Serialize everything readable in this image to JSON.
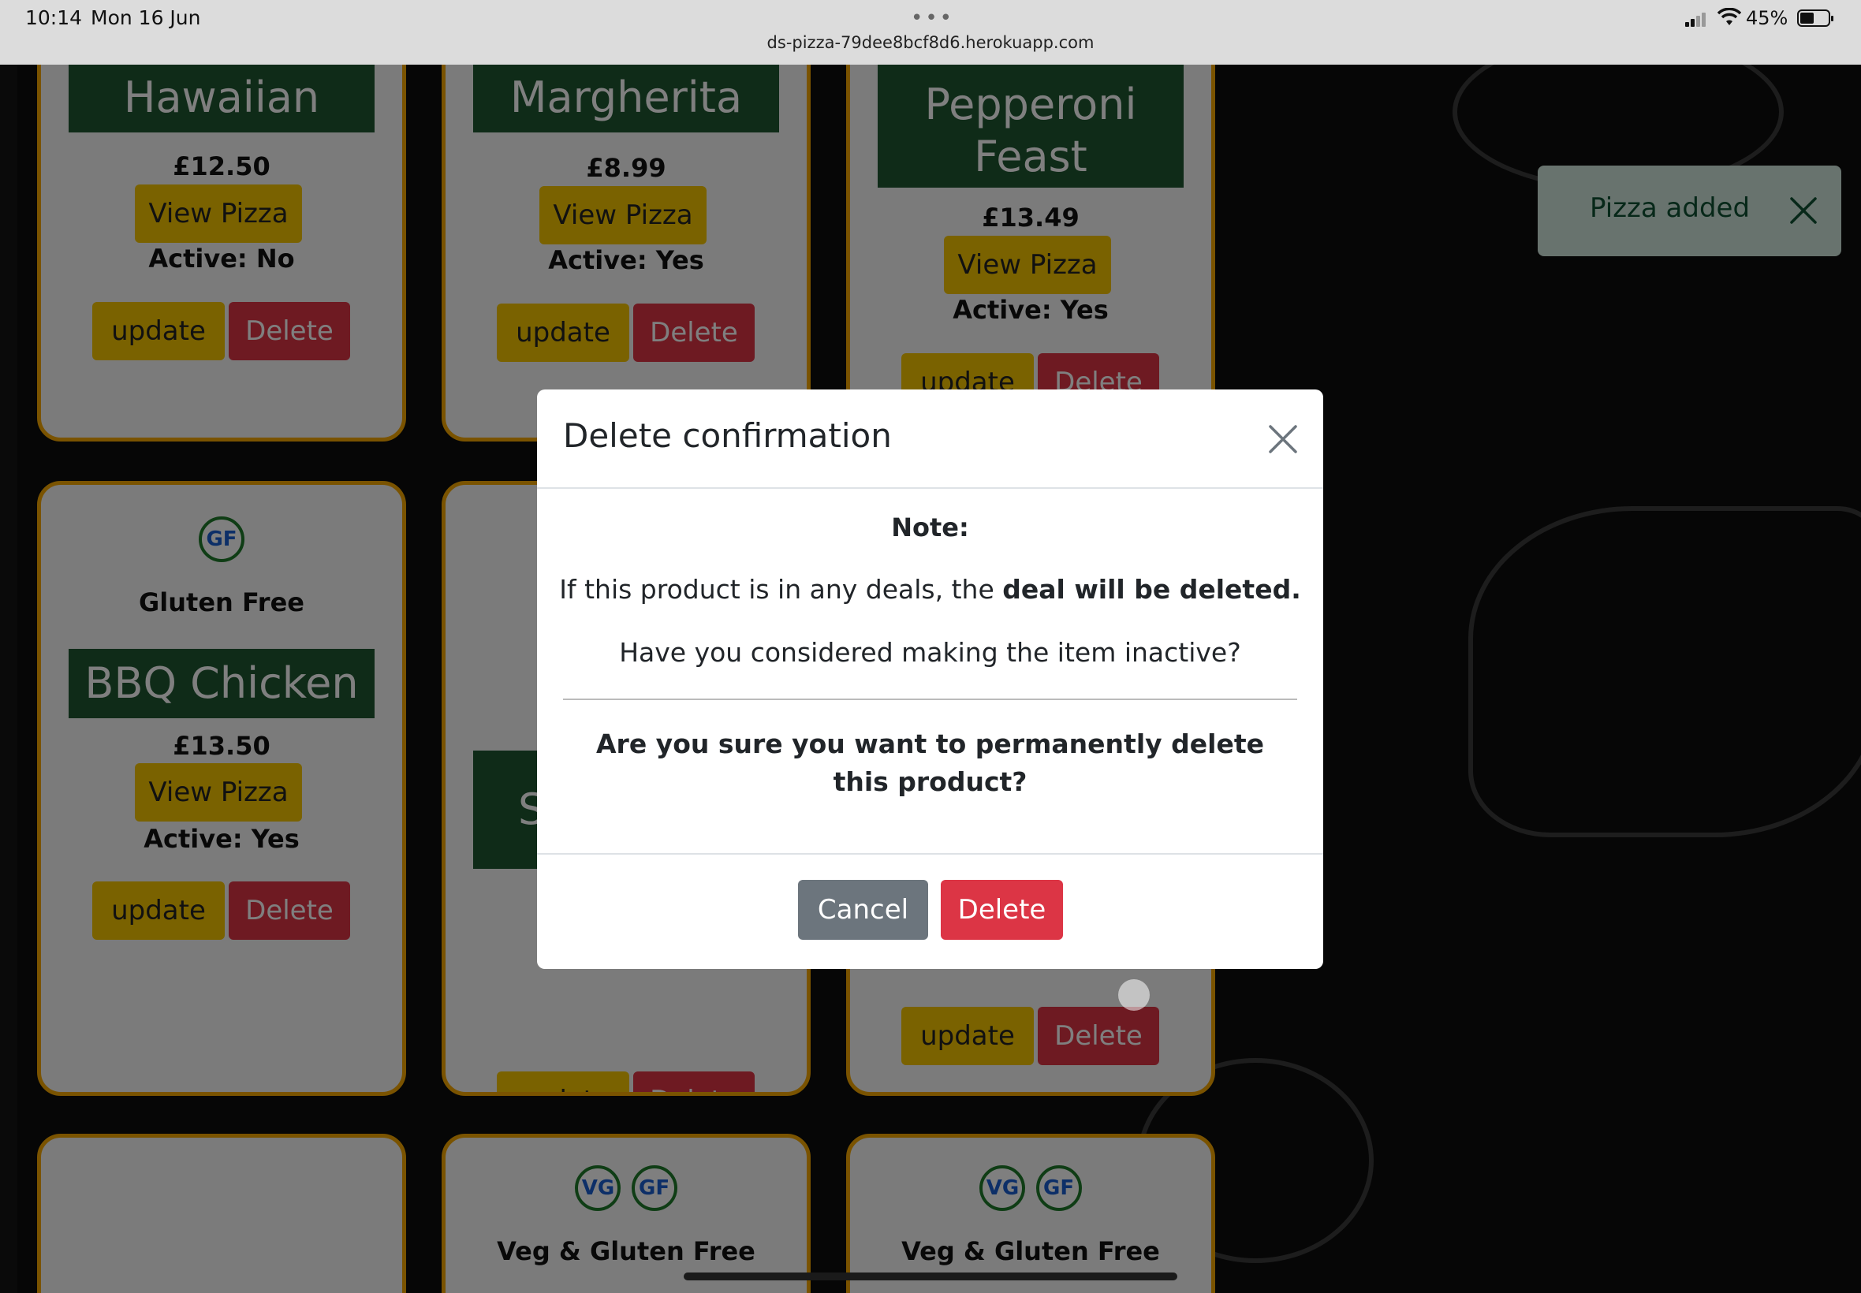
{
  "status_bar": {
    "time": "10:14",
    "date": "Mon 16 Jun",
    "url": "ds-pizza-79dee8bcf8d6.herokuapp.com",
    "battery": "45%"
  },
  "toast": {
    "message": "Pizza added"
  },
  "cards": [
    {
      "name": "Hawaiian",
      "price": "£12.50",
      "view": "View Pizza",
      "active": "Active: No",
      "update": "update",
      "delete": "Delete"
    },
    {
      "name": "Margherita",
      "price": "£8.99",
      "view": "View Pizza",
      "active": "Active: Yes",
      "update": "update",
      "delete": "Delete"
    },
    {
      "name": "Pepperoni Feast",
      "price": "£13.49",
      "view": "View Pizza",
      "active": "Active: Yes",
      "update": "update",
      "delete": "Delete"
    },
    {
      "badges": [
        "GF"
      ],
      "diet": "Gluten Free",
      "name": "BBQ Chicken",
      "price": "£13.50",
      "view": "View Pizza",
      "active": "Active: Yes",
      "update": "update",
      "delete": "Delete"
    },
    {
      "name_partial": "S",
      "update": "update",
      "delete": "Delete"
    },
    {
      "update": "update",
      "delete": "Delete"
    },
    {},
    {
      "badges": [
        "VG",
        "GF"
      ],
      "diet": "Veg & Gluten Free"
    },
    {
      "badges": [
        "VG",
        "GF"
      ],
      "diet": "Veg & Gluten Free"
    }
  ],
  "modal": {
    "title": "Delete confirmation",
    "note": "Note:",
    "deals_text": "If this product is in any deals, the ",
    "deals_bold": "deal will be deleted.",
    "inactive_question": "Have you considered making the item inactive?",
    "confirm_question": "Are you sure you want to permanently delete this product?",
    "cancel_label": "Cancel",
    "delete_label": "Delete"
  },
  "colors": {
    "card_border": "#f5a700",
    "name_banner": "#1e5631",
    "primary_button": "#f5c400",
    "danger": "#dc3545",
    "secondary": "#6c757d",
    "toast_bg": "#d1e7dd"
  }
}
